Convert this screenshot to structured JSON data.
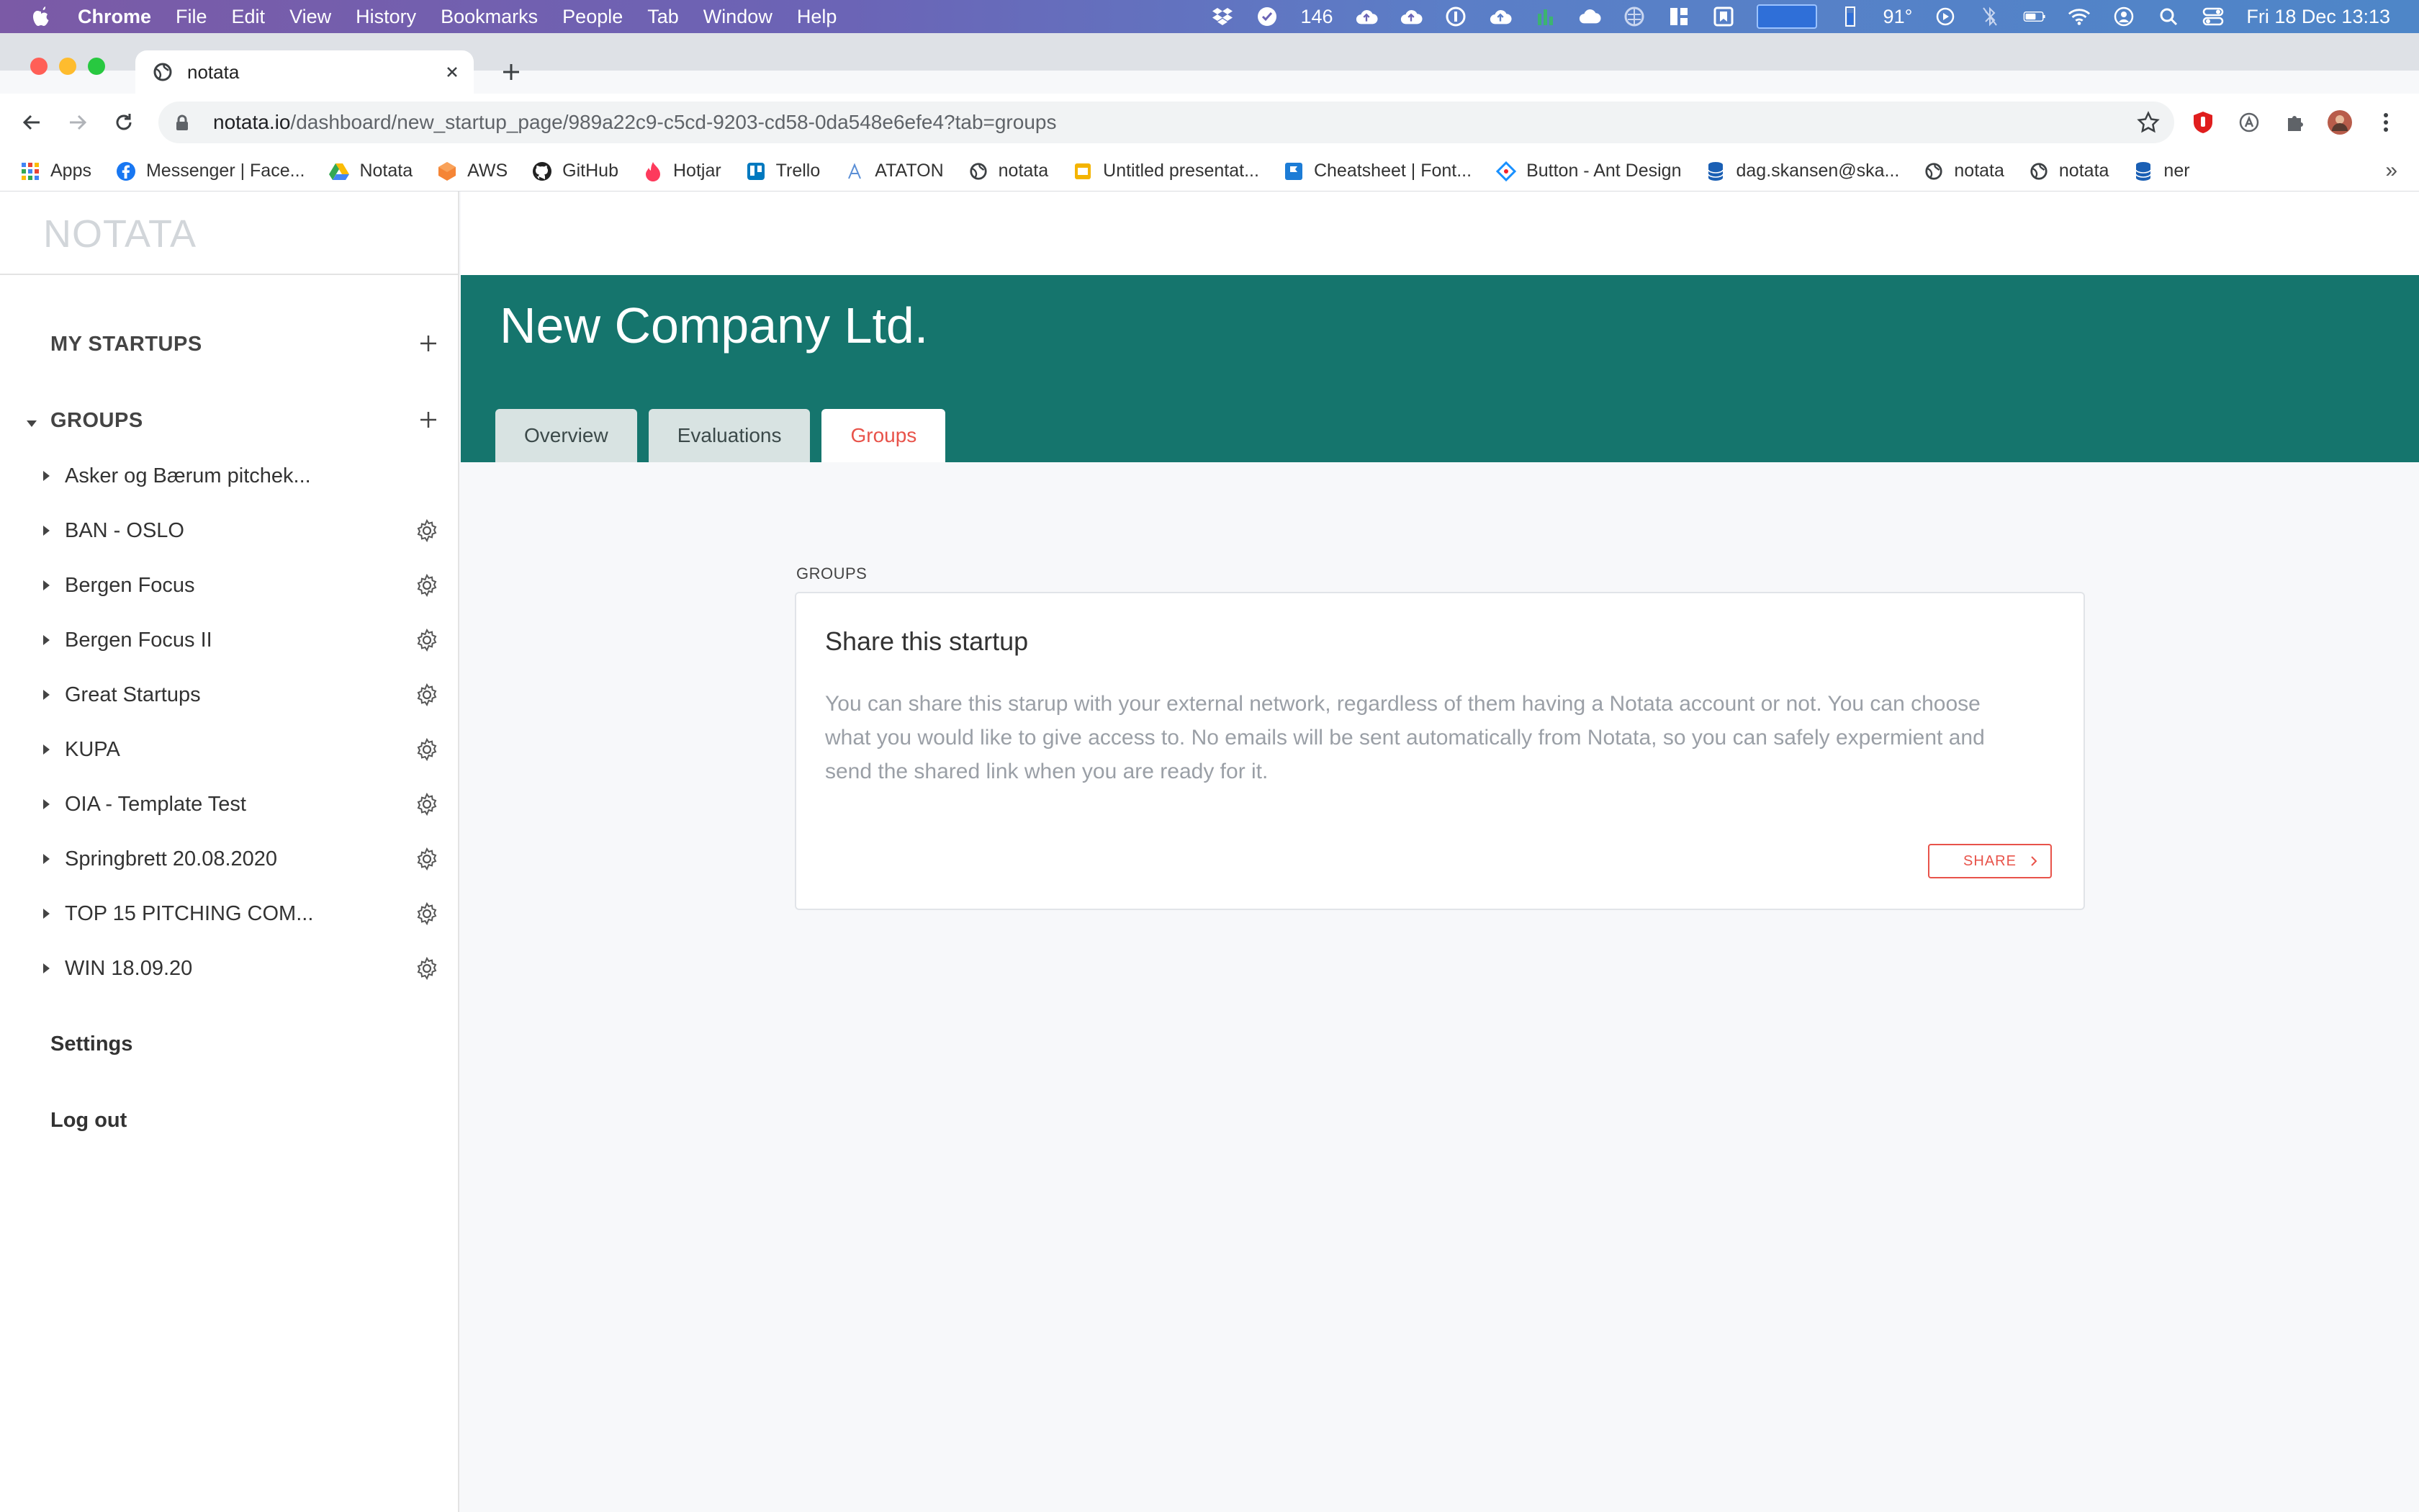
{
  "menubar": {
    "app": "Chrome",
    "items": [
      "File",
      "Edit",
      "View",
      "History",
      "Bookmarks",
      "People",
      "Tab",
      "Window",
      "Help"
    ],
    "status": {
      "counter": "146",
      "temperature": "91°",
      "datetime": "Fri 18 Dec  13:13"
    }
  },
  "browser": {
    "tab_title": "notata",
    "url_host": "notata.io",
    "url_path": "/dashboard/new_startup_page/989a22c9-c5cd-9203-cd58-0da548e6efe4?tab=groups"
  },
  "bookmarks": [
    {
      "label": "Apps",
      "icon": "apps-grid-icon"
    },
    {
      "label": "Messenger | Face...",
      "icon": "facebook-icon"
    },
    {
      "label": "Notata",
      "icon": "google-drive-icon"
    },
    {
      "label": "AWS",
      "icon": "aws-icon"
    },
    {
      "label": "GitHub",
      "icon": "github-icon"
    },
    {
      "label": "Hotjar",
      "icon": "hotjar-icon"
    },
    {
      "label": "Trello",
      "icon": "trello-icon"
    },
    {
      "label": "ATATON",
      "icon": "ataton-icon"
    },
    {
      "label": "notata",
      "icon": "globe-icon"
    },
    {
      "label": "Untitled presentat...",
      "icon": "slides-icon"
    },
    {
      "label": "Cheatsheet | Font...",
      "icon": "flag-icon"
    },
    {
      "label": "Button - Ant Design",
      "icon": "ant-design-icon"
    },
    {
      "label": "dag.skansen@ska...",
      "icon": "database-icon"
    },
    {
      "label": "notata",
      "icon": "globe-icon"
    },
    {
      "label": "notata",
      "icon": "globe-icon"
    },
    {
      "label": "ner",
      "icon": "database-icon"
    }
  ],
  "bookmarks_more": "»",
  "app": {
    "logo": "NOTATA",
    "sidebar": {
      "my_startups": "MY STARTUPS",
      "groups_heading": "GROUPS",
      "groups": [
        {
          "label": "Asker og Bærum pitchek...",
          "has_settings": false
        },
        {
          "label": "BAN - OSLO",
          "has_settings": true
        },
        {
          "label": "Bergen Focus",
          "has_settings": true
        },
        {
          "label": "Bergen Focus II",
          "has_settings": true
        },
        {
          "label": "Great Startups",
          "has_settings": true
        },
        {
          "label": "KUPA",
          "has_settings": true
        },
        {
          "label": "OIA - Template Test",
          "has_settings": true
        },
        {
          "label": "Springbrett 20.08.2020",
          "has_settings": true
        },
        {
          "label": "TOP 15 PITCHING COM...",
          "has_settings": true
        },
        {
          "label": "WIN 18.09.20",
          "has_settings": true
        }
      ],
      "settings": "Settings",
      "logout": "Log out"
    },
    "header": {
      "company_name": "New Company Ltd.",
      "tabs": [
        {
          "label": "Overview",
          "active": false
        },
        {
          "label": "Evaluations",
          "active": false
        },
        {
          "label": "Groups",
          "active": true
        }
      ]
    },
    "groups_section": {
      "label": "GROUPS",
      "card_title": "Share this startup",
      "card_text": "You can share this starup with your external network, regardless of them having a Notata account or not. You can choose what you would like to give access to. No emails will be sent automatically from Notata, so you can safely expermient and send the shared link when you are ready for it.",
      "share_button": "SHARE"
    }
  },
  "colors": {
    "brand_teal": "#15756d",
    "accent_red": "#e8534a"
  }
}
